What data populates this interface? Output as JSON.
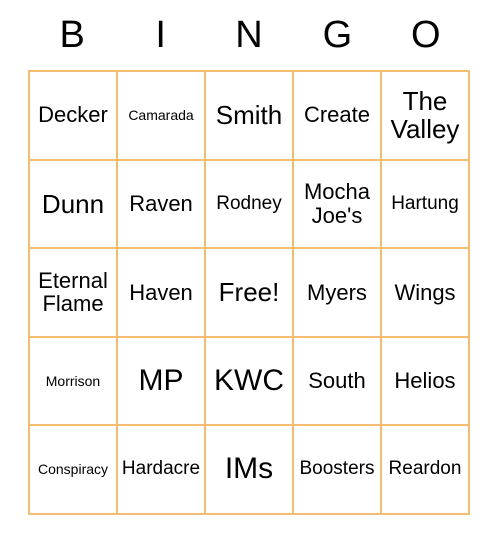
{
  "card": {
    "title": "BINGO",
    "header_letters": [
      "B",
      "I",
      "N",
      "G",
      "O"
    ],
    "border_color": "#f5bd72",
    "text_color": "#000000",
    "background_color": "#ffffff",
    "grid_size": "5x5",
    "free_space_label": "Free!",
    "rows": [
      [
        {
          "label": "Decker",
          "size": "m"
        },
        {
          "label": "Camarada",
          "size": "xs"
        },
        {
          "label": "Smith",
          "size": "l"
        },
        {
          "label": "Create",
          "size": "m"
        },
        {
          "label": "The Valley",
          "size": "l"
        }
      ],
      [
        {
          "label": "Dunn",
          "size": "l"
        },
        {
          "label": "Raven",
          "size": "m"
        },
        {
          "label": "Rodney",
          "size": "s"
        },
        {
          "label": "Mocha Joe's",
          "size": "m"
        },
        {
          "label": "Hartung",
          "size": "s"
        }
      ],
      [
        {
          "label": "Eternal Flame",
          "size": "m"
        },
        {
          "label": "Haven",
          "size": "m"
        },
        {
          "label": "Free!",
          "size": "l"
        },
        {
          "label": "Myers",
          "size": "m"
        },
        {
          "label": "Wings",
          "size": "m"
        }
      ],
      [
        {
          "label": "Morrison",
          "size": "xs"
        },
        {
          "label": "MP",
          "size": "xl"
        },
        {
          "label": "KWC",
          "size": "xl"
        },
        {
          "label": "South",
          "size": "m"
        },
        {
          "label": "Helios",
          "size": "m"
        }
      ],
      [
        {
          "label": "Conspiracy",
          "size": "xs"
        },
        {
          "label": "Hardacre",
          "size": "s"
        },
        {
          "label": "IMs",
          "size": "xl"
        },
        {
          "label": "Boosters",
          "size": "s"
        },
        {
          "label": "Reardon",
          "size": "s"
        }
      ]
    ]
  }
}
